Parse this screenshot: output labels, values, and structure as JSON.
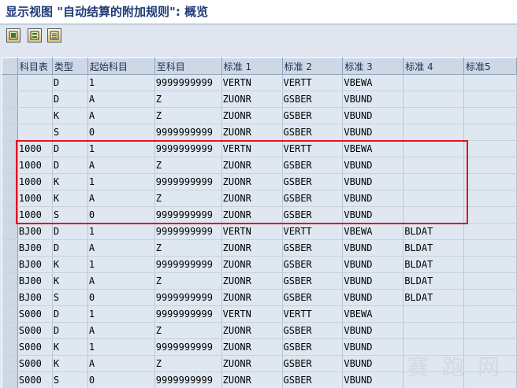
{
  "title": "显示视图 \"自动结算的附加规则\": 概览",
  "toolbar": {
    "buttons": [
      {
        "name": "select-all-icon"
      },
      {
        "name": "select-block-icon"
      },
      {
        "name": "details-icon"
      }
    ]
  },
  "columns": [
    "科目表",
    "类型",
    "起始科目",
    "至科目",
    "标准 1",
    "标准 2",
    "标准 3",
    "标准 4",
    "标准5"
  ],
  "rows": [
    [
      "",
      "D",
      "1",
      "9999999999",
      "VERTN",
      "VERTT",
      "VBEWA",
      "",
      ""
    ],
    [
      "",
      "D",
      "A",
      "Z",
      "ZUONR",
      "GSBER",
      "VBUND",
      "",
      ""
    ],
    [
      "",
      "K",
      "A",
      "Z",
      "ZUONR",
      "GSBER",
      "VBUND",
      "",
      ""
    ],
    [
      "",
      "S",
      "0",
      "9999999999",
      "ZUONR",
      "GSBER",
      "VBUND",
      "",
      ""
    ],
    [
      "1000",
      "D",
      "1",
      "9999999999",
      "VERTN",
      "VERTT",
      "VBEWA",
      "",
      ""
    ],
    [
      "1000",
      "D",
      "A",
      "Z",
      "ZUONR",
      "GSBER",
      "VBUND",
      "",
      ""
    ],
    [
      "1000",
      "K",
      "1",
      "9999999999",
      "ZUONR",
      "GSBER",
      "VBUND",
      "",
      ""
    ],
    [
      "1000",
      "K",
      "A",
      "Z",
      "ZUONR",
      "GSBER",
      "VBUND",
      "",
      ""
    ],
    [
      "1000",
      "S",
      "0",
      "9999999999",
      "ZUONR",
      "GSBER",
      "VBUND",
      "",
      ""
    ],
    [
      "BJ00",
      "D",
      "1",
      "9999999999",
      "VERTN",
      "VERTT",
      "VBEWA",
      "BLDAT",
      ""
    ],
    [
      "BJ00",
      "D",
      "A",
      "Z",
      "ZUONR",
      "GSBER",
      "VBUND",
      "BLDAT",
      ""
    ],
    [
      "BJ00",
      "K",
      "1",
      "9999999999",
      "ZUONR",
      "GSBER",
      "VBUND",
      "BLDAT",
      ""
    ],
    [
      "BJ00",
      "K",
      "A",
      "Z",
      "ZUONR",
      "GSBER",
      "VBUND",
      "BLDAT",
      ""
    ],
    [
      "BJ00",
      "S",
      "0",
      "9999999999",
      "ZUONR",
      "GSBER",
      "VBUND",
      "BLDAT",
      ""
    ],
    [
      "S000",
      "D",
      "1",
      "9999999999",
      "VERTN",
      "VERTT",
      "VBEWA",
      "",
      ""
    ],
    [
      "S000",
      "D",
      "A",
      "Z",
      "ZUONR",
      "GSBER",
      "VBUND",
      "",
      ""
    ],
    [
      "S000",
      "K",
      "1",
      "9999999999",
      "ZUONR",
      "GSBER",
      "VBUND",
      "",
      ""
    ],
    [
      "S000",
      "K",
      "A",
      "Z",
      "ZUONR",
      "GSBER",
      "VBUND",
      "",
      ""
    ],
    [
      "S000",
      "S",
      "0",
      "9999999999",
      "ZUONR",
      "GSBER",
      "VBUND",
      "",
      ""
    ]
  ],
  "highlight_color": "#e0141c",
  "watermark": "赛 跑 网"
}
